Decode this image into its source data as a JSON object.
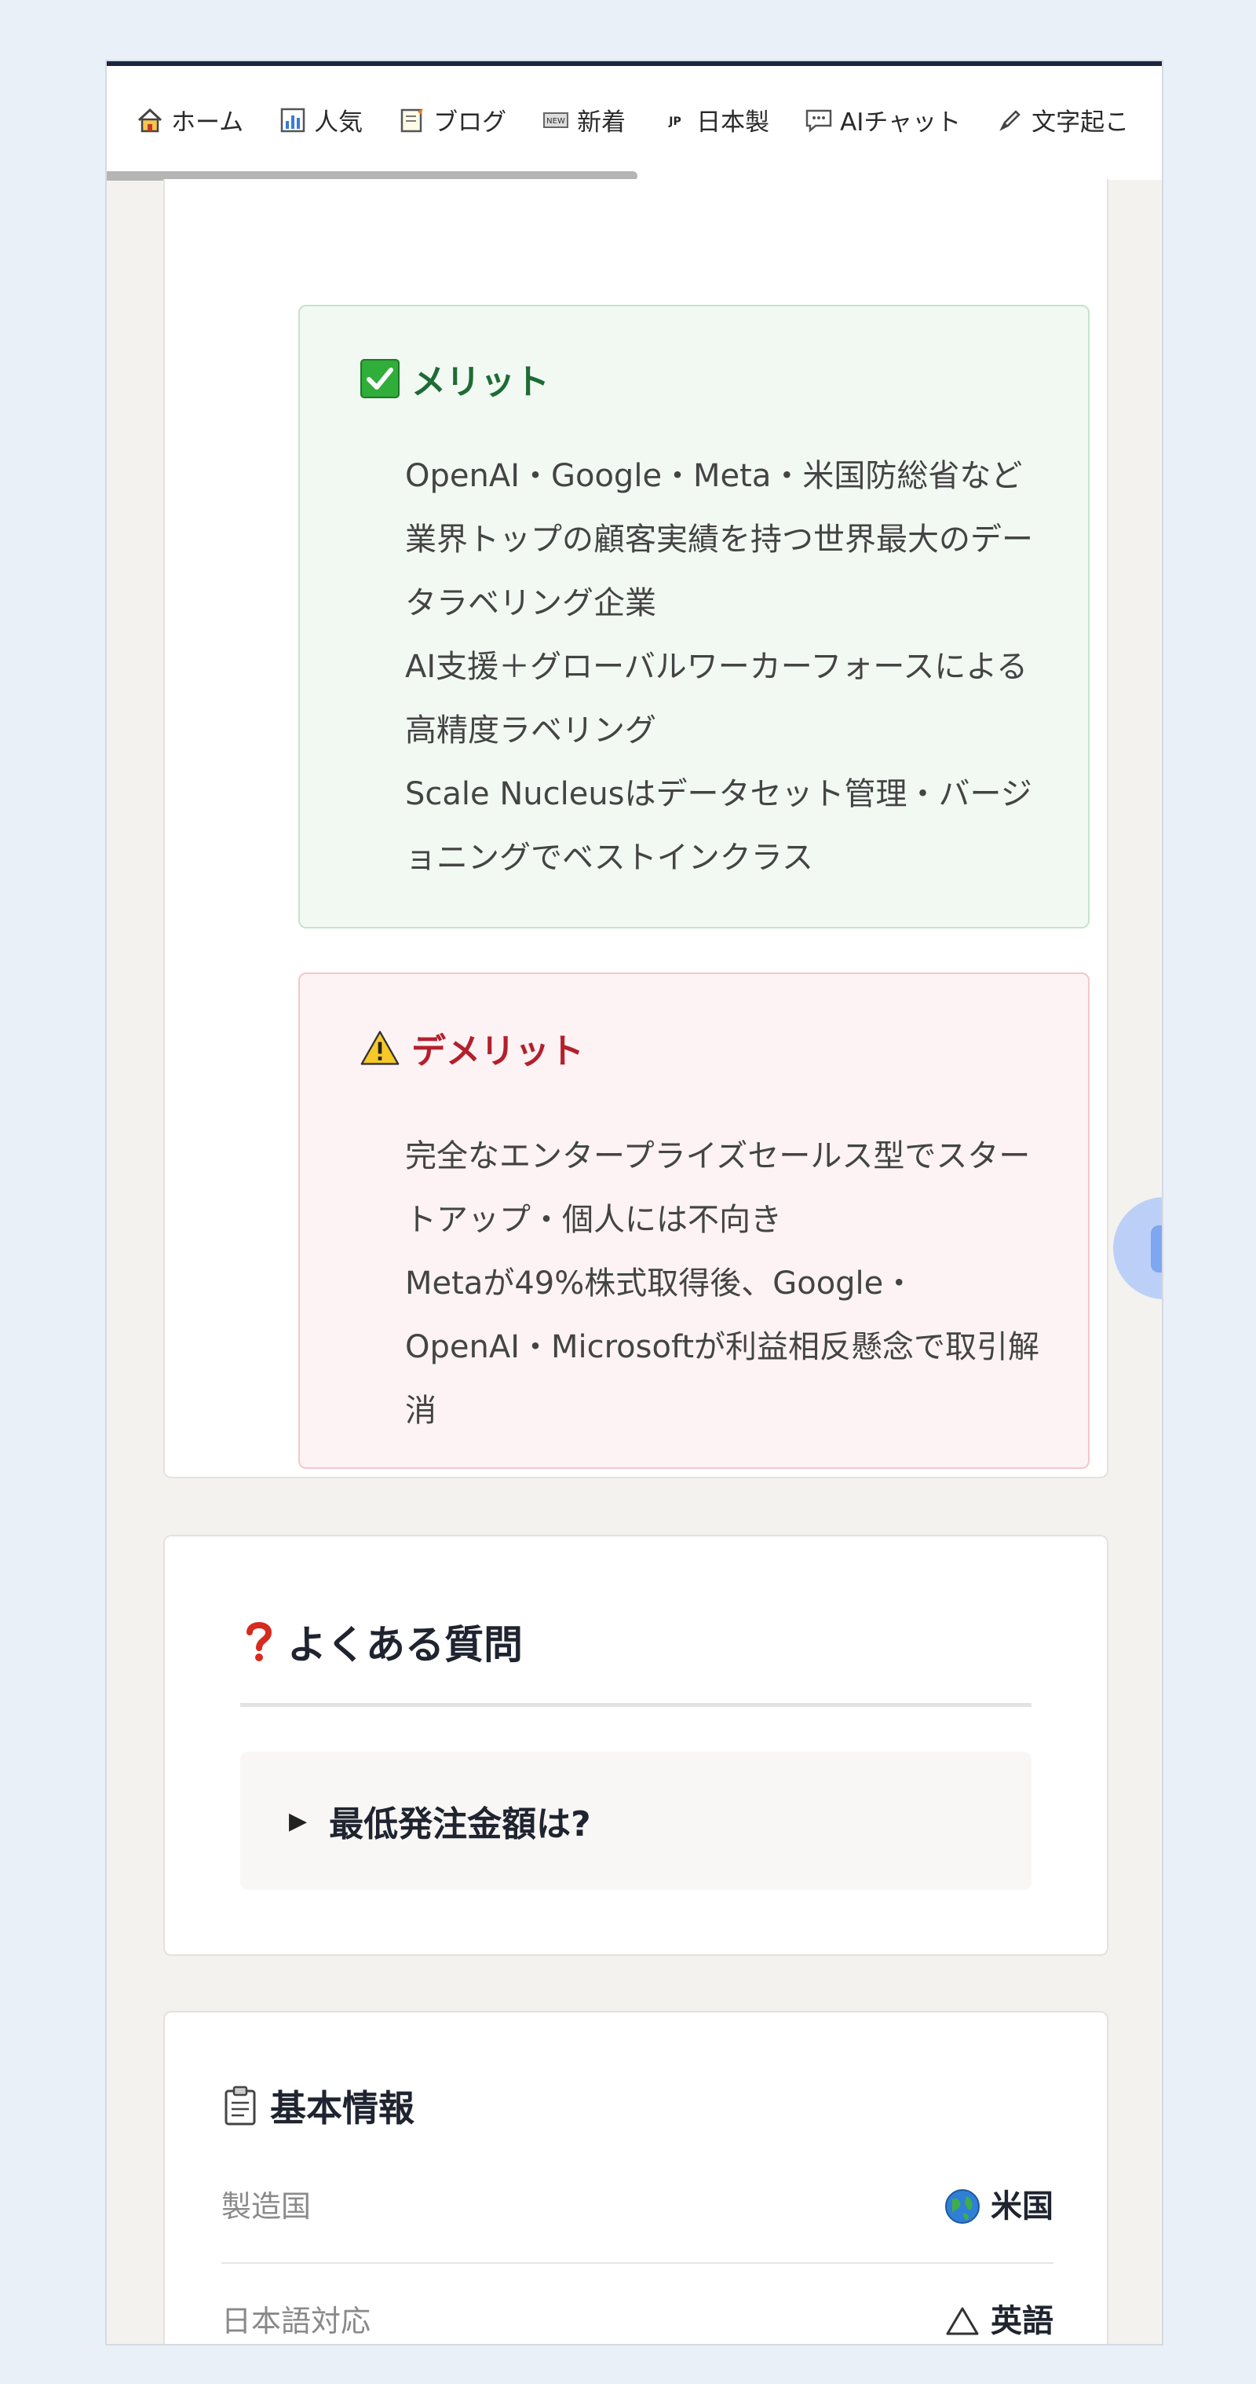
{
  "nav": {
    "items": [
      {
        "label": "ホーム",
        "icon": "home-icon"
      },
      {
        "label": "人気",
        "icon": "chart-icon"
      },
      {
        "label": "ブログ",
        "icon": "memo-icon"
      },
      {
        "label": "新着",
        "icon": "new-icon"
      },
      {
        "label": "日本製",
        "icon": "jp-flag-icon"
      },
      {
        "label": "AIチャット",
        "icon": "chat-icon"
      },
      {
        "label": "文字起こ",
        "icon": "pen-icon"
      }
    ]
  },
  "merit": {
    "title": "メリット",
    "icon": "check-icon",
    "items": [
      "OpenAI・Google・Meta・米国防総省など業界トップの顧客実績を持つ世界最大のデータラベリング企業",
      "AI支援＋グローバルワーカーフォースによる高精度ラベリング",
      "Scale Nucleusはデータセット管理・バージョニングでベストインクラス"
    ]
  },
  "demerit": {
    "title": "デメリット",
    "icon": "warning-icon",
    "items": [
      "完全なエンタープライズセールス型でスタートアップ・個人には不向き",
      "Metaが49%株式取得後、Google・OpenAI・Microsoftが利益相反懸念で取引解消"
    ]
  },
  "faq": {
    "title": "よくある質問",
    "icon": "question-icon",
    "items": [
      {
        "question": "最低発注金額は?"
      }
    ]
  },
  "basic_info": {
    "title": "基本情報",
    "icon": "clipboard-icon",
    "rows": [
      {
        "key": "製造国",
        "value": "米国",
        "icon": "globe-icon"
      },
      {
        "key": "日本語対応",
        "value": "英語",
        "icon": "triangle-icon"
      }
    ]
  },
  "colors": {
    "merit_title": "#1e6b35",
    "demerit_title": "#b3202c",
    "nav_border": "#1b2541"
  }
}
